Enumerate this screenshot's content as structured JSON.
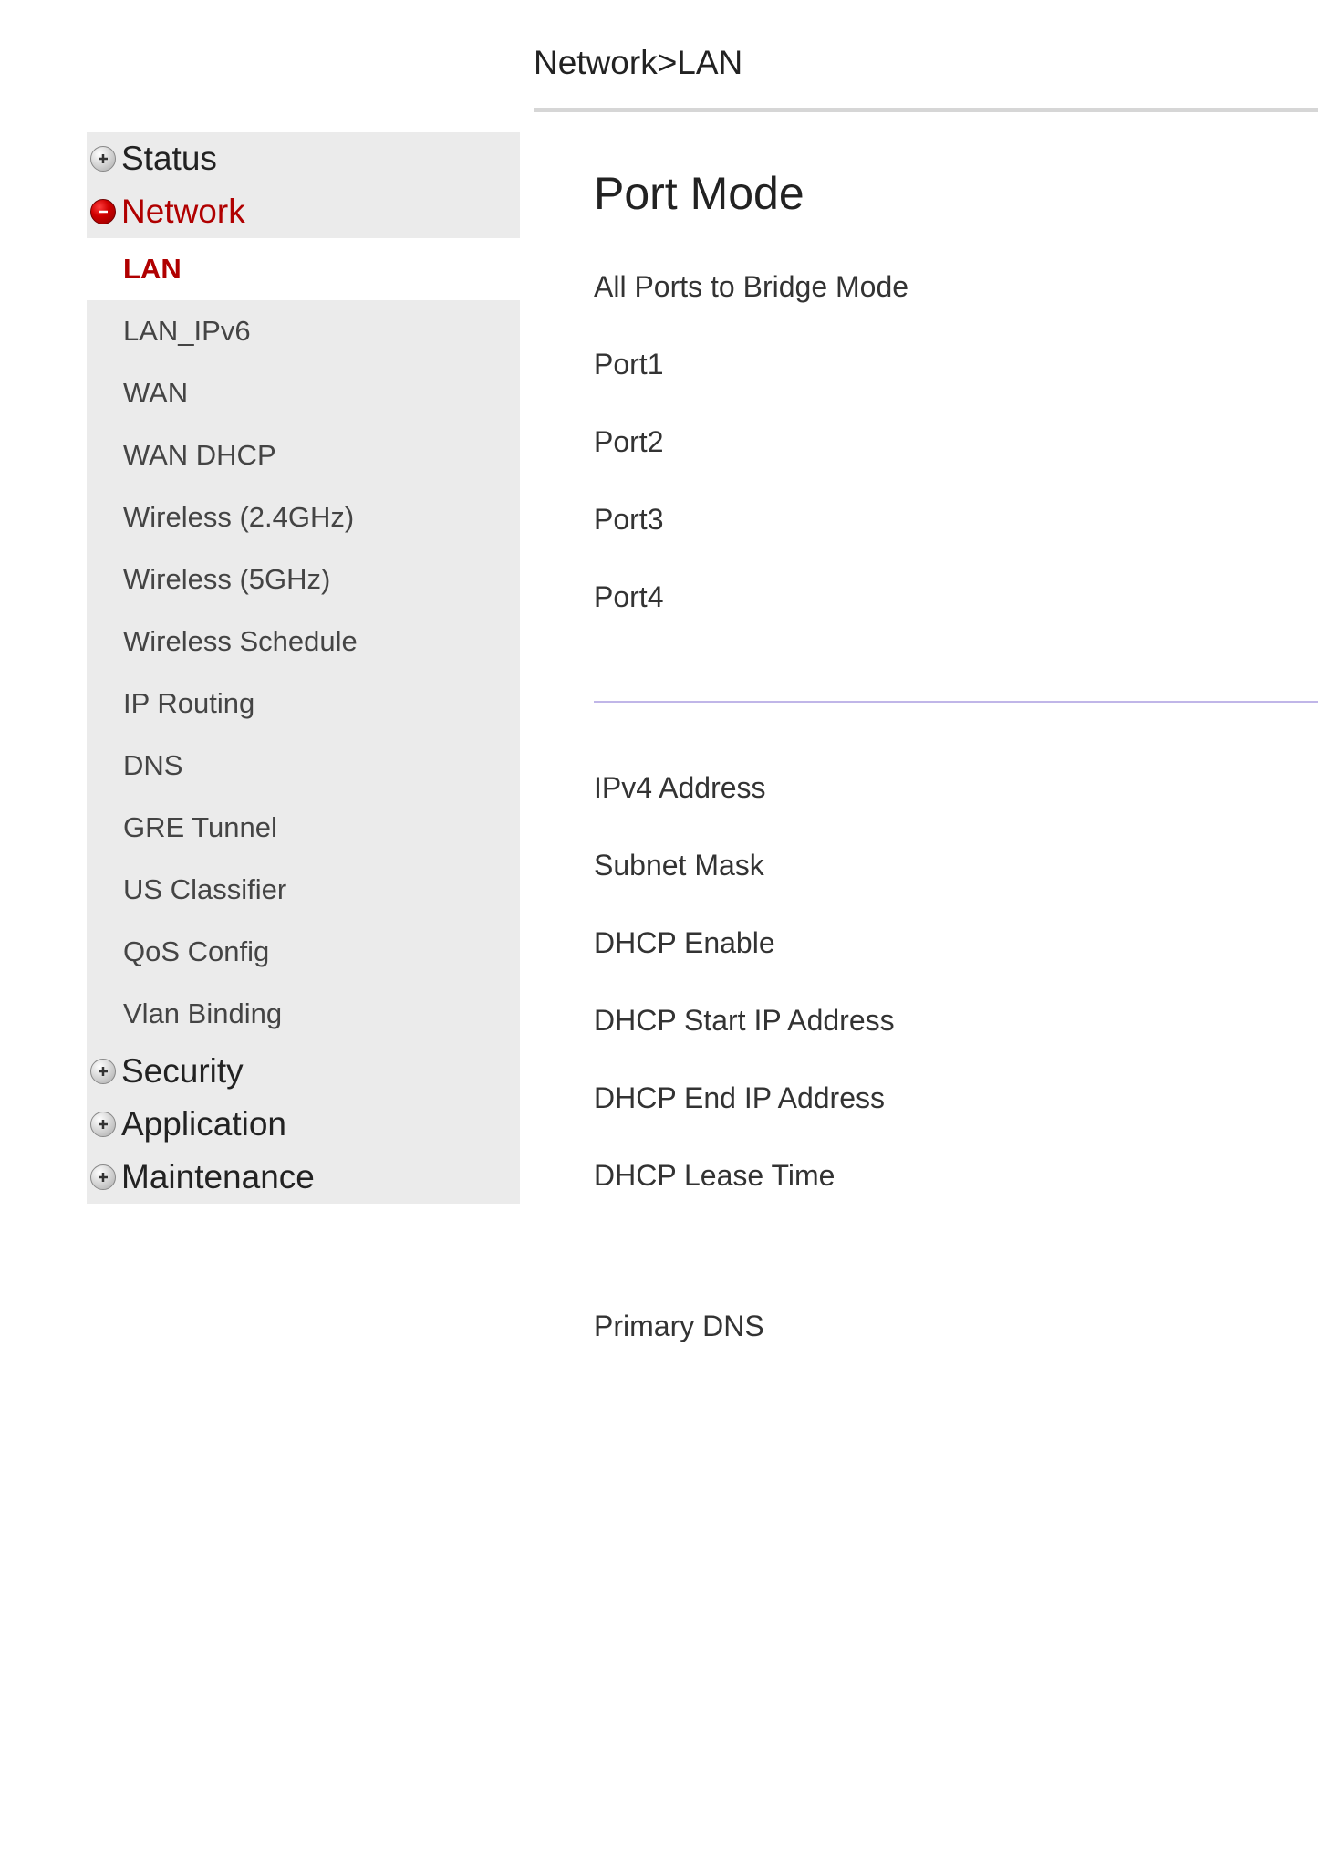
{
  "breadcrumb": "Network>LAN",
  "sidebar": {
    "sections": [
      {
        "label": "Status",
        "expanded": false
      },
      {
        "label": "Network",
        "expanded": true,
        "items": [
          {
            "label": "LAN",
            "active": true
          },
          {
            "label": "LAN_IPv6",
            "active": false
          },
          {
            "label": "WAN",
            "active": false
          },
          {
            "label": "WAN DHCP",
            "active": false
          },
          {
            "label": "Wireless (2.4GHz)",
            "active": false
          },
          {
            "label": "Wireless (5GHz)",
            "active": false
          },
          {
            "label": "Wireless Schedule",
            "active": false
          },
          {
            "label": "IP Routing",
            "active": false
          },
          {
            "label": "DNS",
            "active": false
          },
          {
            "label": "GRE Tunnel",
            "active": false
          },
          {
            "label": "US Classifier",
            "active": false
          },
          {
            "label": "QoS Config",
            "active": false
          },
          {
            "label": "Vlan Binding",
            "active": false
          }
        ]
      },
      {
        "label": "Security",
        "expanded": false
      },
      {
        "label": "Application",
        "expanded": false
      },
      {
        "label": "Maintenance",
        "expanded": false
      }
    ]
  },
  "main": {
    "section_title": "Port Mode",
    "port_fields": [
      "All Ports to Bridge Mode",
      "Port1",
      "Port2",
      "Port3",
      "Port4"
    ],
    "lan_fields": [
      "IPv4 Address",
      "Subnet Mask",
      "DHCP Enable",
      "DHCP Start IP Address",
      "DHCP End IP Address",
      "DHCP Lease Time",
      "Primary DNS"
    ]
  }
}
